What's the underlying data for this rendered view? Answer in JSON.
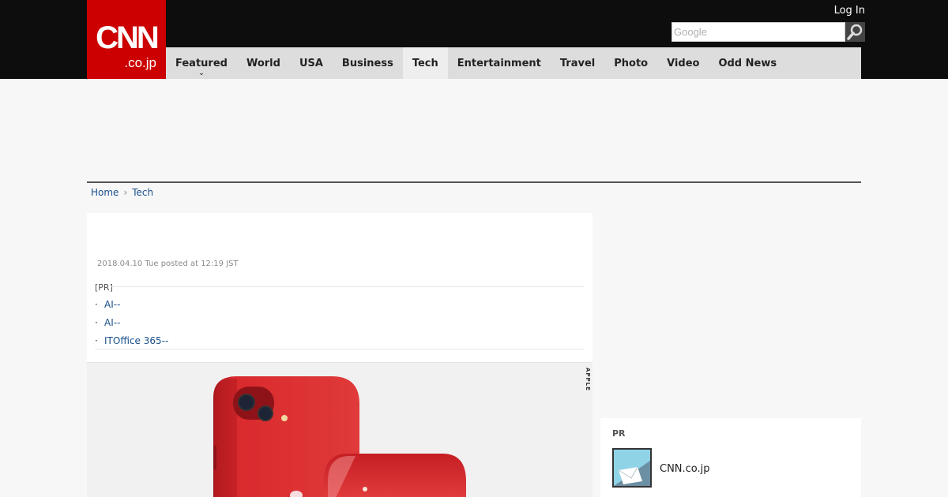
{
  "logo": {
    "main": "CNN",
    "sub": ".co.jp"
  },
  "header": {
    "login_label": "Log In",
    "search_placeholder": "Google"
  },
  "nav": {
    "items": [
      {
        "label": "Featured"
      },
      {
        "label": "World"
      },
      {
        "label": "USA"
      },
      {
        "label": "Business"
      },
      {
        "label": "Tech"
      },
      {
        "label": "Entertainment"
      },
      {
        "label": "Travel"
      },
      {
        "label": "Photo"
      },
      {
        "label": "Video"
      },
      {
        "label": "Odd News"
      }
    ],
    "active": "Tech"
  },
  "breadcrumb": {
    "home": "Home",
    "current": "Tech"
  },
  "article": {
    "posted": "2018.04.10 Tue posted at 12:19 JST",
    "pr_label": "[PR]",
    "pr_links": [
      "AI--",
      "AI--",
      "ITOffice 365--"
    ],
    "photo_credit": "APPLE"
  },
  "sidebar_pr": {
    "label": "PR",
    "item_title": "CNN.co.jp"
  },
  "colors": {
    "brand_red": "#cc0000",
    "topbar": "#0d0d0d",
    "nav_bg": "#dddddd",
    "link": "#1a4f8b"
  }
}
